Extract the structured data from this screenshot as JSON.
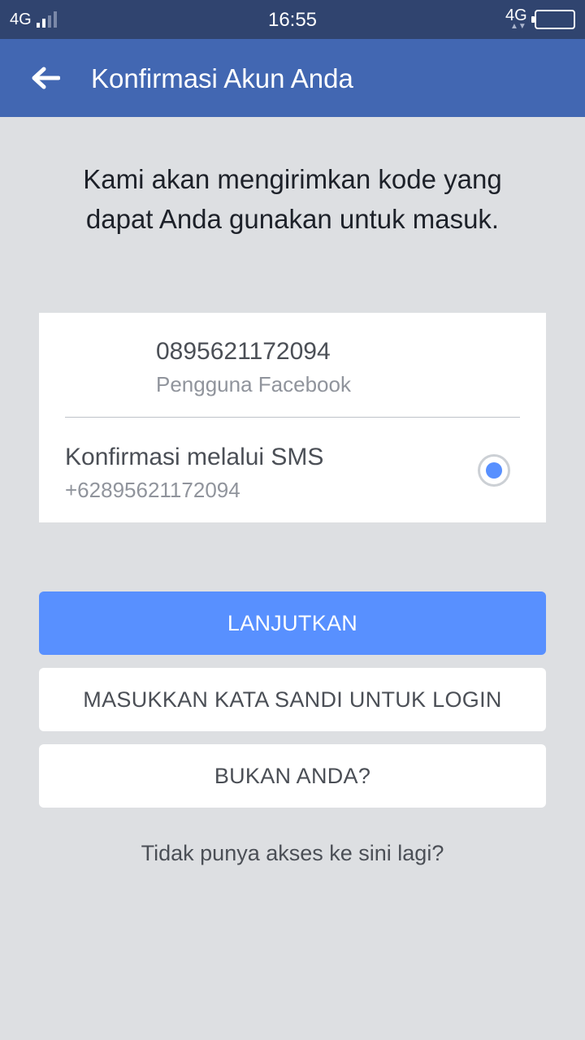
{
  "status_bar": {
    "network_left": "4G",
    "time": "16:55",
    "network_right": "4G",
    "network_right_arrows": "▲▼"
  },
  "app_bar": {
    "title": "Konfirmasi Akun Anda",
    "back_icon": "back-arrow-icon",
    "background": "#4267b2"
  },
  "intro": {
    "text": "Kami akan mengirimkan kode yang dapat Anda gunakan untuk masuk."
  },
  "account": {
    "number": "0895621172094",
    "name": "Pengguna Facebook"
  },
  "options": [
    {
      "label": "Konfirmasi melalui SMS",
      "detail": "+62895621172094",
      "selected": true
    }
  ],
  "buttons": {
    "continue": "LANJUTKAN",
    "password_login": "MASUKKAN KATA SANDI UNTUK LOGIN",
    "not_you": "BUKAN ANDA?"
  },
  "links": {
    "no_access": "Tidak punya akses ke sini lagi?"
  },
  "colors": {
    "accent": "#5890ff",
    "page_background": "#dddfe2",
    "status_bar": "#30446f"
  }
}
